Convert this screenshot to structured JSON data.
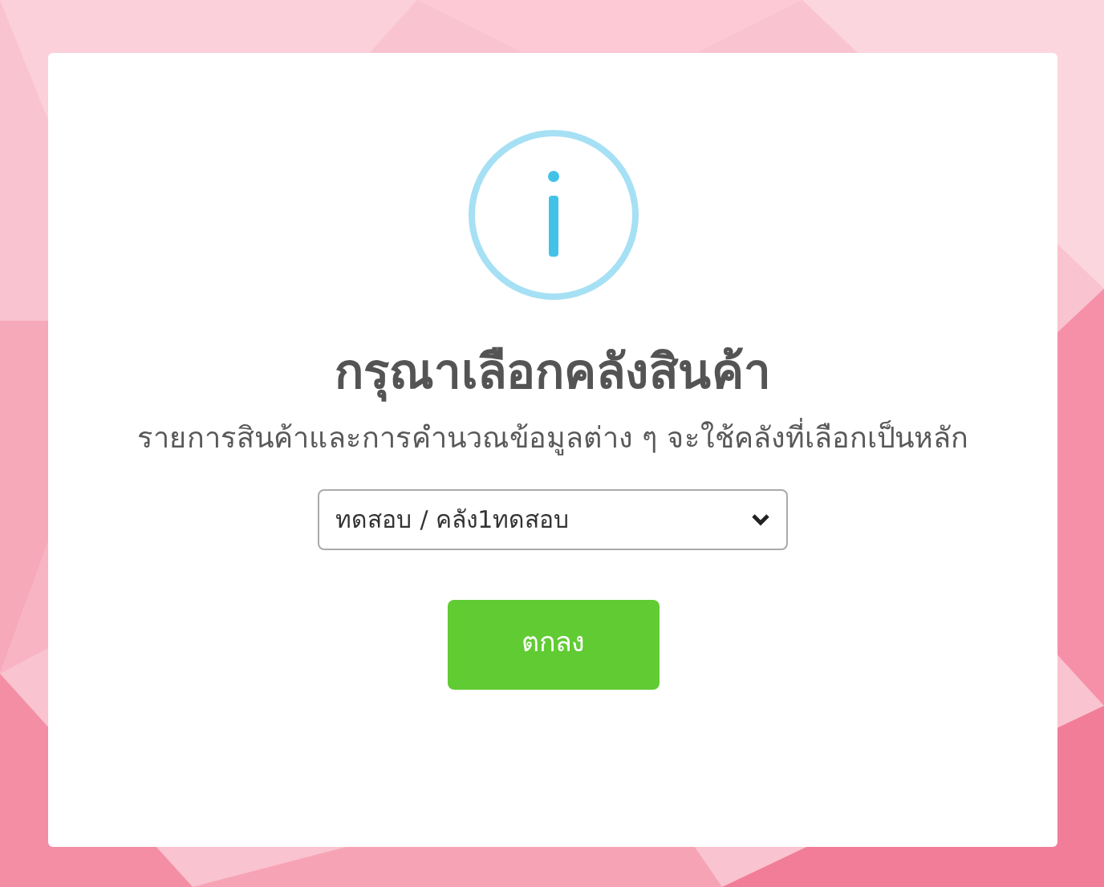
{
  "dialog": {
    "title": "กรุณาเลือกคลังสินค้า",
    "message": "รายการสินค้าและการคำนวณข้อมูลต่าง ๆ จะใช้คลังที่เลือกเป็นหลัก",
    "warehouse_select": {
      "value": "ทดสอบ / คลัง1ทดสอบ"
    },
    "confirm_button": "ตกลง"
  }
}
